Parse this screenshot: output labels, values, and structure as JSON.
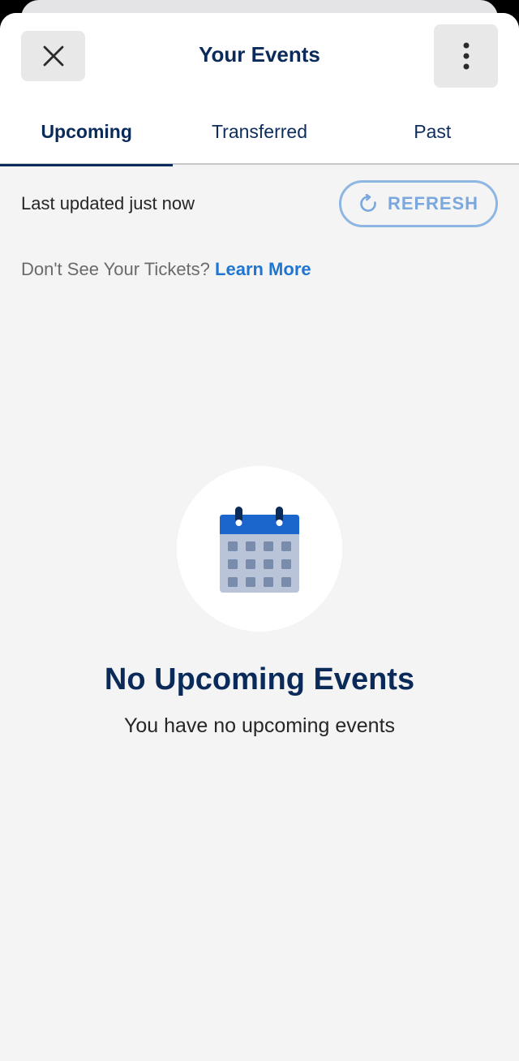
{
  "header": {
    "title": "Your Events"
  },
  "tabs": [
    {
      "label": "Upcoming",
      "active": true
    },
    {
      "label": "Transferred",
      "active": false
    },
    {
      "label": "Past",
      "active": false
    }
  ],
  "status": {
    "last_updated": "Last updated just now",
    "refresh_label": "REFRESH"
  },
  "help": {
    "prompt": "Don't See Your Tickets?",
    "link": "Learn More"
  },
  "empty_state": {
    "icon": "calendar-icon",
    "title": "No Upcoming Events",
    "subtitle": "You have no upcoming events"
  },
  "colors": {
    "primary_navy": "#0a2a5a",
    "link_blue": "#1f76d2",
    "refresh_blue": "#8eb6e3",
    "background": "#f4f4f4"
  }
}
